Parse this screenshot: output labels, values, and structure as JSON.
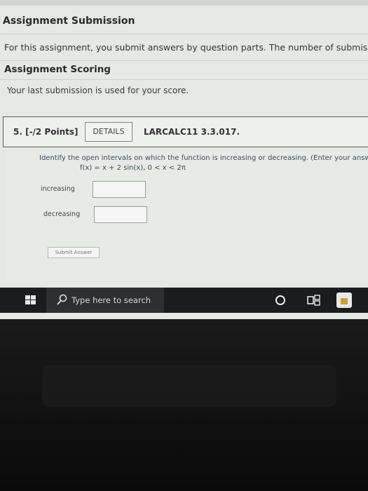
{
  "submission": {
    "title": "Assignment Submission",
    "info": "For this assignment, you submit answers by question parts. The number of submissions re"
  },
  "scoring": {
    "title": "Assignment Scoring",
    "text": "Your last submission is used for your score."
  },
  "question": {
    "points": "5. [-/2 Points]",
    "details_label": "DETAILS",
    "id": "LARCALC11 3.3.017.",
    "prompt": "Identify the open intervals on which the function is increasing or decreasing. (Enter your answ",
    "function": "f(x) = x + 2 sin(x),    0 < x < 2π",
    "increasing_label": "increasing",
    "increasing_value": "",
    "decreasing_label": "decreasing",
    "decreasing_value": "",
    "submit_label": "Submit Answer"
  },
  "taskbar": {
    "search_placeholder": "Type here to search",
    "icons": [
      "windows-logo-icon",
      "search-icon",
      "cortana-icon",
      "task-view-icon",
      "store-icon"
    ]
  }
}
